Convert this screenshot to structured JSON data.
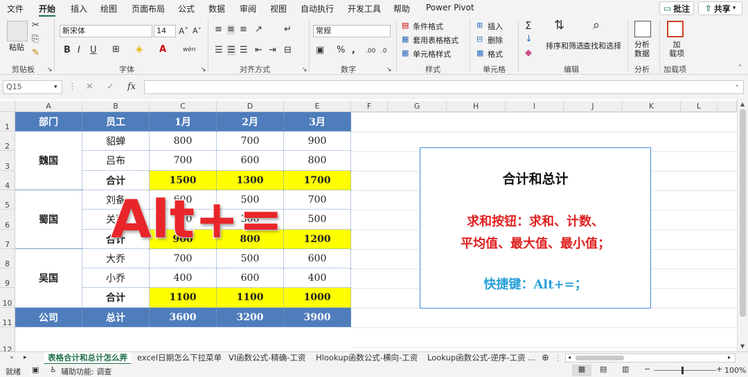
{
  "menu": {
    "items": [
      "文件",
      "开始",
      "插入",
      "绘图",
      "页面布局",
      "公式",
      "数据",
      "审阅",
      "视图",
      "自动执行",
      "开发工具",
      "帮助",
      "Power Pivot"
    ],
    "active": "开始",
    "comment_label": "批注",
    "share_label": "共享"
  },
  "ribbon": {
    "clipboard": {
      "paste": "粘贴",
      "group": "剪贴板"
    },
    "font": {
      "name": "新宋体",
      "size": "14",
      "group": "字体",
      "bold": "B",
      "italic": "I",
      "underline": "U"
    },
    "alignment": {
      "group": "对齐方式"
    },
    "number": {
      "format": "常规",
      "group": "数字"
    },
    "styles": {
      "conditional": "条件格式",
      "table": "套用表格格式",
      "cell": "单元格样式",
      "group": "样式"
    },
    "cells": {
      "insert": "插入",
      "delete": "删除",
      "format": "格式",
      "group": "单元格"
    },
    "editing": {
      "sort": "排序和筛选",
      "find": "查找和选择",
      "group": "编辑"
    },
    "analysis": {
      "analyze": "分析\n数据",
      "group": "分析"
    },
    "addins": {
      "addin": "加\n载项",
      "group": "加载项"
    }
  },
  "formula_bar": {
    "name_box": "Q15",
    "content": ""
  },
  "columns": [
    "A",
    "B",
    "C",
    "D",
    "E",
    "F",
    "G",
    "H",
    "I",
    "J",
    "K",
    "L"
  ],
  "rows": [
    "1",
    "2",
    "3",
    "4",
    "5",
    "6",
    "7",
    "8",
    "9",
    "10",
    "11",
    "12"
  ],
  "table": {
    "header": [
      "部门",
      "员工",
      "1月",
      "2月",
      "3月"
    ],
    "groups": [
      {
        "dept": "魏国",
        "rows": [
          [
            "貂蝉",
            "800",
            "700",
            "900"
          ],
          [
            "吕布",
            "700",
            "600",
            "800"
          ],
          [
            "合计",
            "1500",
            "1300",
            "1700"
          ]
        ]
      },
      {
        "dept": "蜀国",
        "rows": [
          [
            "刘备",
            "600",
            "500",
            "700"
          ],
          [
            "关羽",
            "300",
            "300",
            "500"
          ],
          [
            "合计",
            "900",
            "800",
            "1200"
          ]
        ]
      },
      {
        "dept": "吴国",
        "rows": [
          [
            "大乔",
            "700",
            "500",
            "600"
          ],
          [
            "小乔",
            "400",
            "600",
            "400"
          ],
          [
            "合计",
            "1100",
            "1100",
            "1000"
          ]
        ]
      }
    ],
    "footer": [
      "公司",
      "总计",
      "3600",
      "3200",
      "3900"
    ]
  },
  "overlay": {
    "text": "Alt+="
  },
  "callout": {
    "title": "合计和总计",
    "line1": "求和按钮：求和、计数、",
    "line2": "平均值、最大值、最小值；",
    "shortcut": "快捷键：Alt+=；",
    "red": "#e02020",
    "blue": "#2aa0d8"
  },
  "sheet_tabs": [
    "表格合计和总计怎么弄",
    "excel日期怎么下拉菜单",
    "Vl函数公式-精确-工资",
    "Hlookup函数公式-横向-工资",
    "Lookup函数公式-逆序-工资 ..."
  ],
  "status": {
    "ready": "就绪",
    "accessibility": "辅助功能: 调查",
    "zoom": "100%"
  },
  "colors": {
    "header_blue": "#4f7dbc",
    "highlight_yellow": "#ffff00",
    "excel_green": "#1e7145"
  }
}
